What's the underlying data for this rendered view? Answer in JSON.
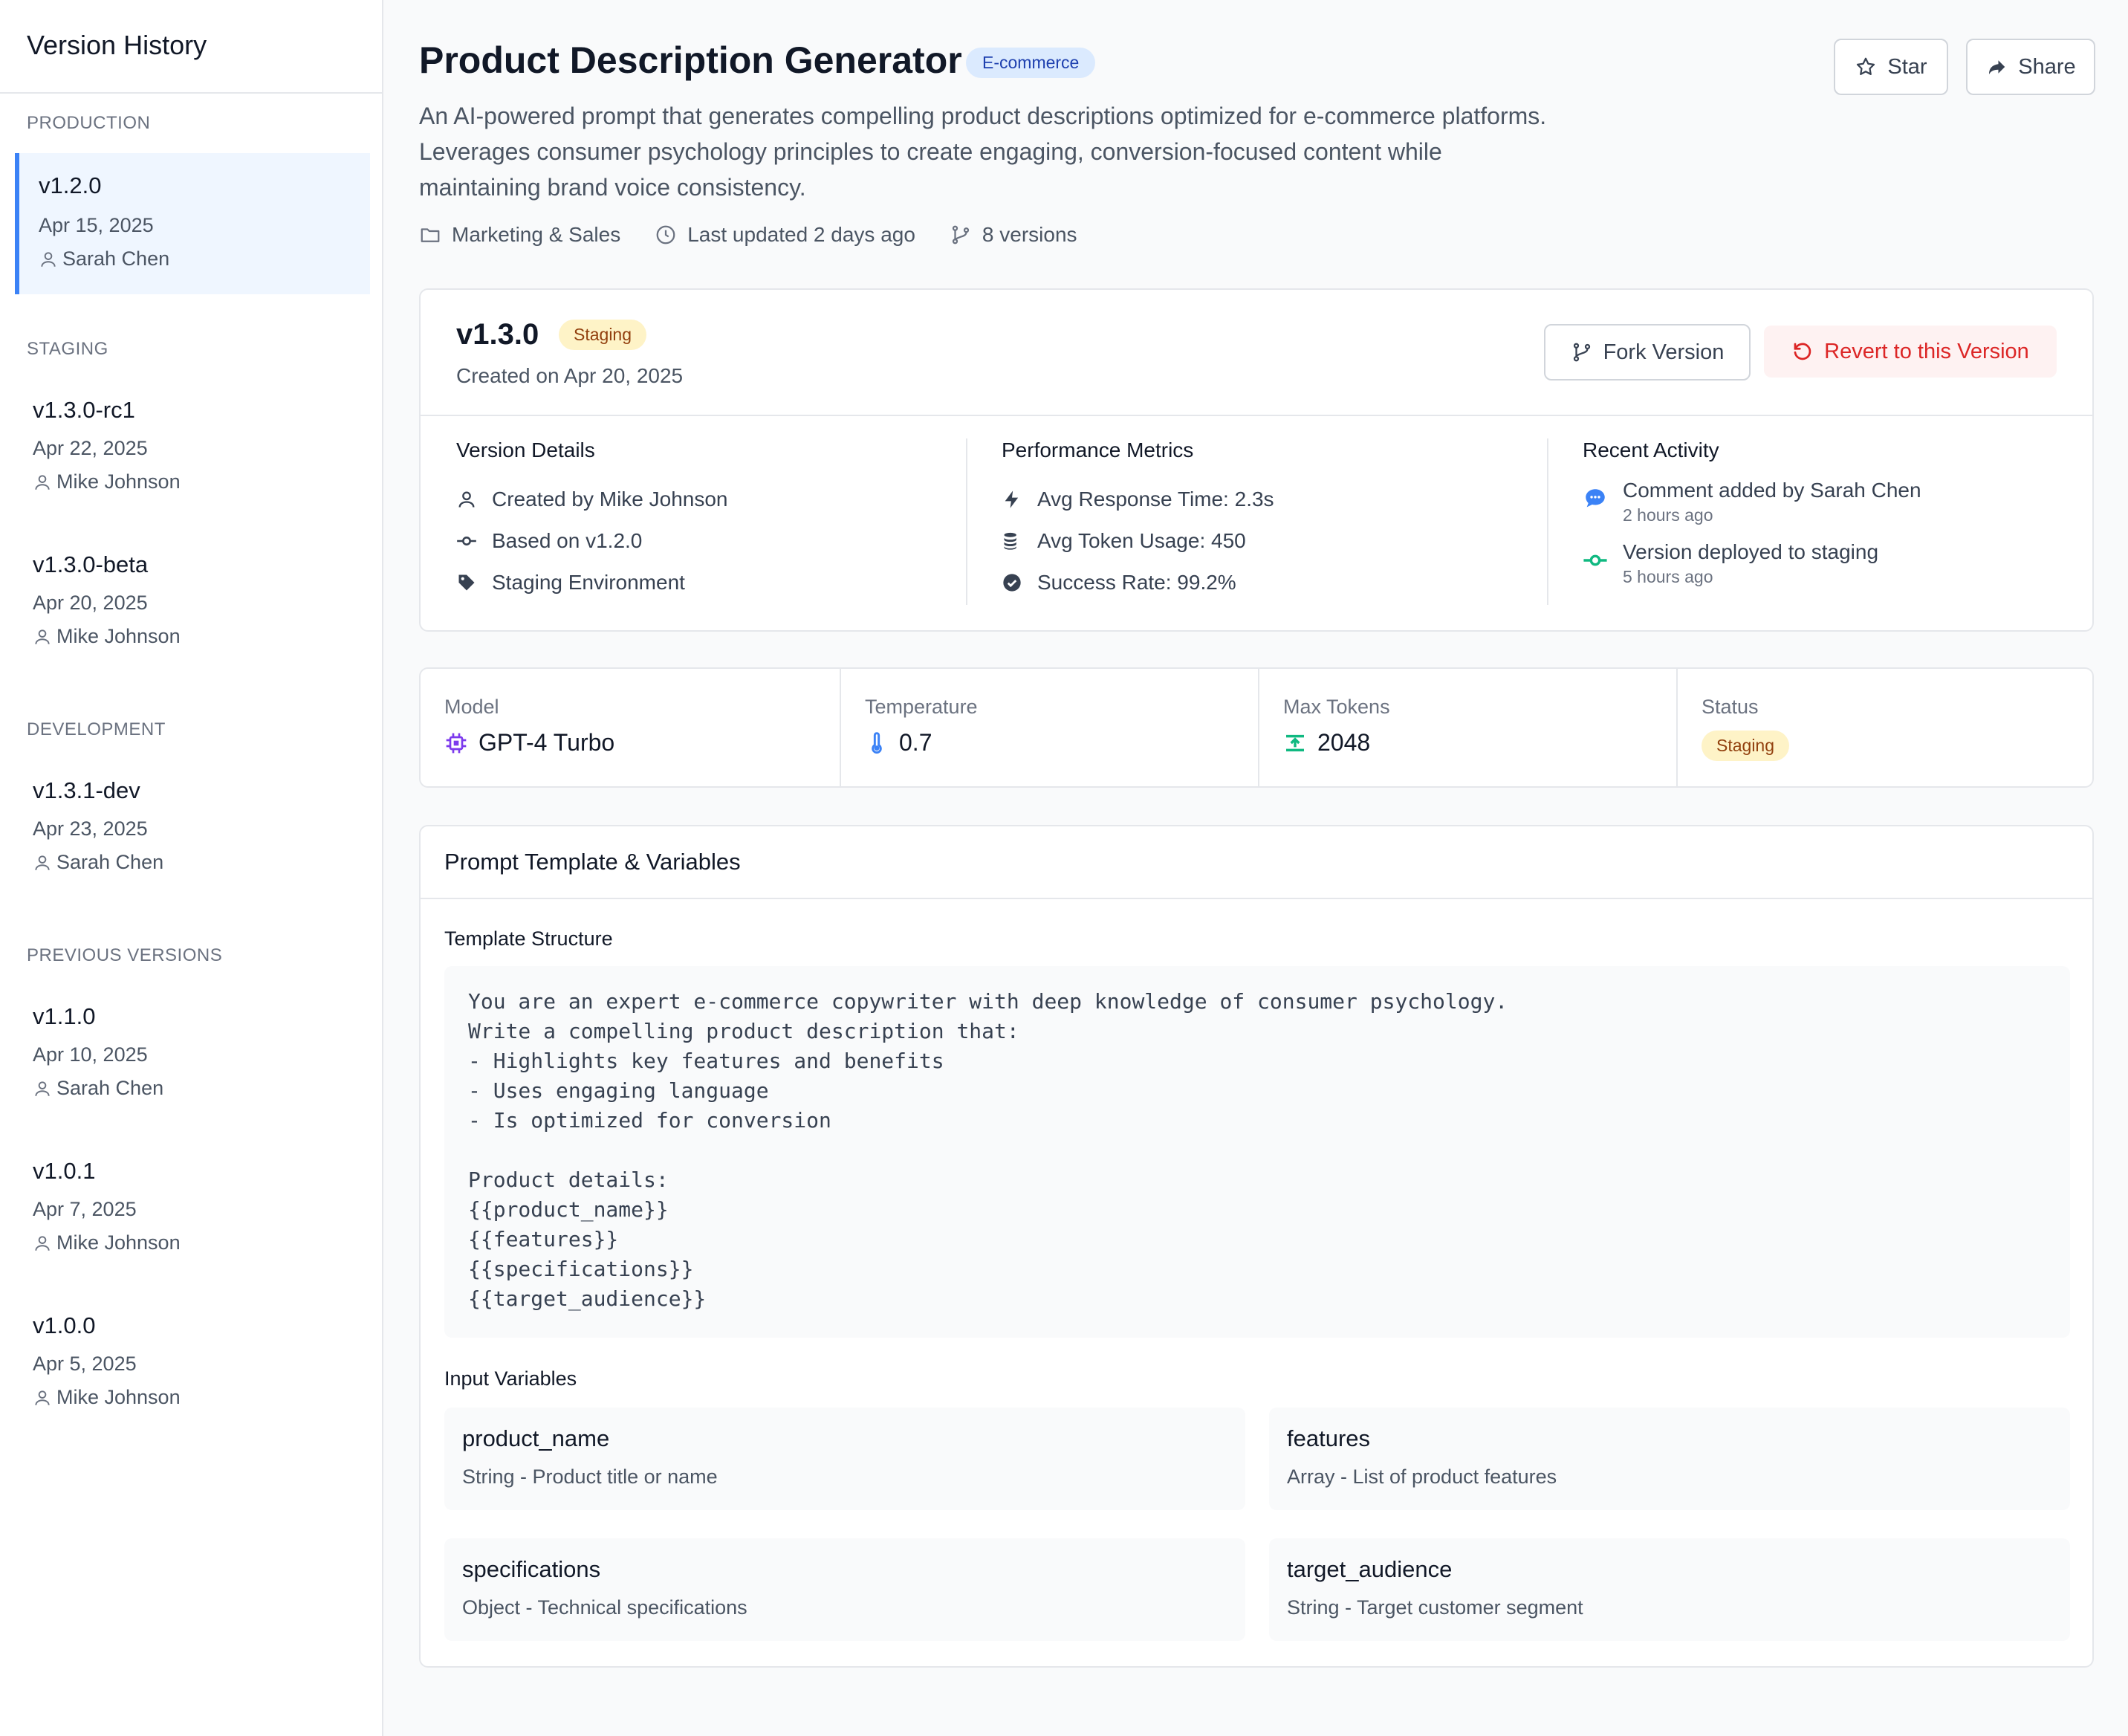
{
  "sidebar": {
    "title": "Version History",
    "sections": [
      {
        "label": "PRODUCTION",
        "items": [
          {
            "version": "v1.2.0",
            "date": "Apr 15, 2025",
            "author": "Sarah Chen",
            "active": true
          }
        ]
      },
      {
        "label": "STAGING",
        "items": [
          {
            "version": "v1.3.0-rc1",
            "date": "Apr 22, 2025",
            "author": "Mike Johnson"
          },
          {
            "version": "v1.3.0-beta",
            "date": "Apr 20, 2025",
            "author": "Mike Johnson"
          }
        ]
      },
      {
        "label": "DEVELOPMENT",
        "items": [
          {
            "version": "v1.3.1-dev",
            "date": "Apr 23, 2025",
            "author": "Sarah Chen"
          }
        ]
      },
      {
        "label": "PREVIOUS VERSIONS",
        "items": [
          {
            "version": "v1.1.0",
            "date": "Apr 10, 2025",
            "author": "Sarah Chen"
          },
          {
            "version": "v1.0.1",
            "date": "Apr 7, 2025",
            "author": "Mike Johnson"
          },
          {
            "version": "v1.0.0",
            "date": "Apr 5, 2025",
            "author": "Mike Johnson"
          }
        ]
      }
    ]
  },
  "header": {
    "title": "Product Description Generator",
    "badge": "E-commerce",
    "star_label": "Star",
    "share_label": "Share",
    "description_lines": [
      "An AI-powered prompt that generates compelling product descriptions optimized for e-commerce platforms.",
      "Leverages consumer psychology principles to create engaging, conversion-focused content while",
      "maintaining brand voice consistency."
    ],
    "category": "Marketing & Sales",
    "updated": "Last updated 2 days ago",
    "versions_count": "8 versions"
  },
  "version_card": {
    "version": "v1.3.0",
    "badge": "Staging",
    "created": "Created on Apr 20, 2025",
    "fork_label": "Fork Version",
    "revert_label": "Revert to this Version",
    "details": {
      "heading": "Version Details",
      "created_by": "Created by Mike Johnson",
      "based_on": "Based on v1.2.0",
      "environment": "Staging Environment"
    },
    "metrics": {
      "heading": "Performance Metrics",
      "response_time": "Avg Response Time: 2.3s",
      "token_usage": "Avg Token Usage: 450",
      "success_rate": "Success Rate: 99.2%"
    },
    "activity": {
      "heading": "Recent Activity",
      "items": [
        {
          "title": "Comment added by Sarah Chen",
          "time": "2 hours ago"
        },
        {
          "title": "Version deployed to staging",
          "time": "5 hours ago"
        }
      ]
    }
  },
  "stats": {
    "model": {
      "label": "Model",
      "value": "GPT-4 Turbo"
    },
    "temperature": {
      "label": "Temperature",
      "value": "0.7"
    },
    "max_tokens": {
      "label": "Max Tokens",
      "value": "2048"
    },
    "status": {
      "label": "Status",
      "value": "Staging"
    }
  },
  "prompt": {
    "heading": "Prompt Template & Variables",
    "template_label": "Template Structure",
    "template": "You are an expert e-commerce copywriter with deep knowledge of consumer psychology.\nWrite a compelling product description that:\n- Highlights key features and benefits\n- Uses engaging language\n- Is optimized for conversion\n\nProduct details:\n{{product_name}}\n{{features}}\n{{specifications}}\n{{target_audience}}",
    "variables_label": "Input Variables",
    "variables": [
      {
        "name": "product_name",
        "desc": "String - Product title or name"
      },
      {
        "name": "features",
        "desc": "Array - List of product features"
      },
      {
        "name": "specifications",
        "desc": "Object - Technical specifications"
      },
      {
        "name": "target_audience",
        "desc": "String - Target customer segment"
      }
    ]
  },
  "colors": {
    "accent": "#3b82f6",
    "staging_bg": "#fef3c7",
    "staging_text": "#92400e",
    "revert_text": "#dc2626",
    "success_green": "#10b981",
    "model_purple": "#7c3aed"
  },
  "icons": {
    "user": "user-icon",
    "folder": "folder-icon",
    "clock": "clock-icon",
    "branch": "git-branch-icon",
    "star": "star-icon",
    "share": "share-icon",
    "fork": "fork-icon",
    "revert": "undo-icon",
    "commit": "git-commit-icon",
    "tag": "tag-icon",
    "bolt": "bolt-icon",
    "coins": "coins-icon",
    "check": "check-circle-icon",
    "comment": "comment-icon",
    "deploy": "deploy-icon",
    "chip": "chip-icon",
    "thermometer": "thermometer-icon",
    "tokens": "tokens-icon"
  }
}
